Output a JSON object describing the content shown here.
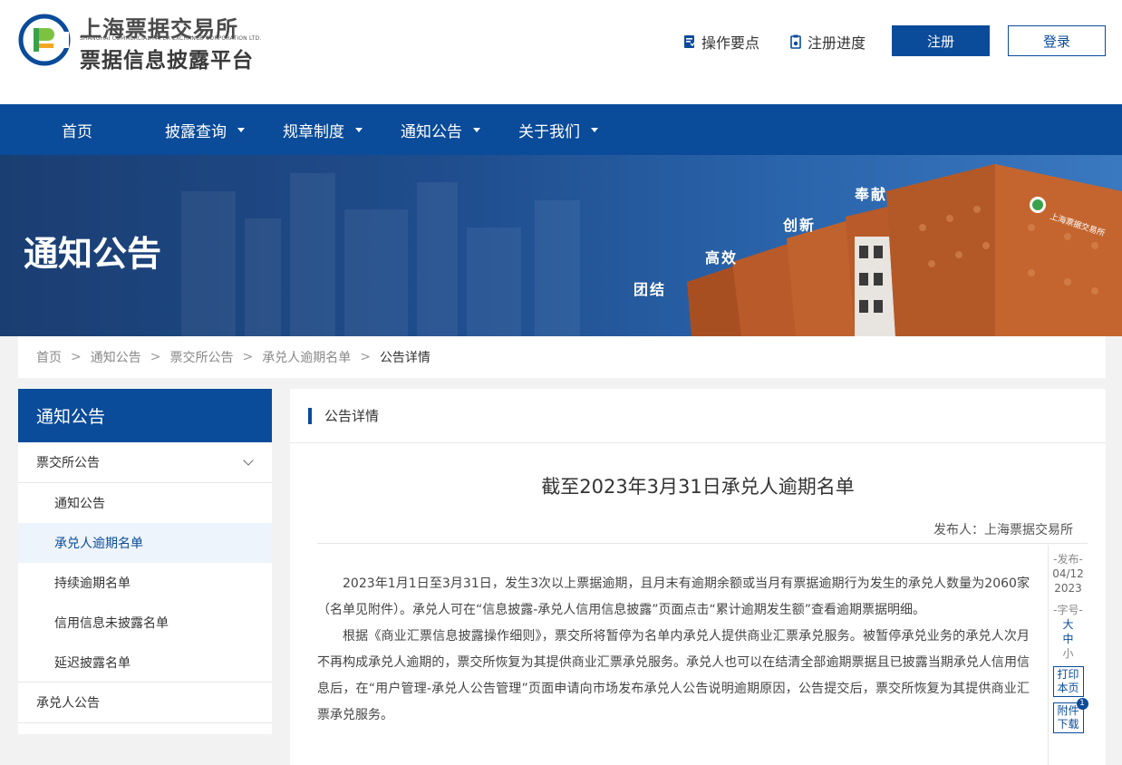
{
  "header": {
    "logo_cn": "上海票据交易所",
    "logo_en": "SHANGHAI COMMERCIAL PAPER EXCHANGE CORPORATION LTD.",
    "logo_sub": "票据信息披露平台",
    "links": [
      {
        "label": "操作要点",
        "icon": "document-icon"
      },
      {
        "label": "注册进度",
        "icon": "clipboard-icon"
      }
    ],
    "register_label": "注册",
    "login_label": "登录"
  },
  "nav": {
    "items": [
      {
        "label": "首页",
        "has_dropdown": false
      },
      {
        "label": "披露查询",
        "has_dropdown": true
      },
      {
        "label": "规章制度",
        "has_dropdown": true
      },
      {
        "label": "通知公告",
        "has_dropdown": true
      },
      {
        "label": "关于我们",
        "has_dropdown": true
      }
    ]
  },
  "banner": {
    "title": "通知公告",
    "mottos": [
      "团结",
      "高效",
      "创新",
      "奉献"
    ],
    "building_sign": "上海票据交易所"
  },
  "breadcrumb": [
    "首页",
    "通知公告",
    "票交所公告",
    "承兑人逾期名单",
    "公告详情"
  ],
  "sidebar": {
    "title": "通知公告",
    "group1": "票交所公告",
    "subitems": [
      "通知公告",
      "承兑人逾期名单",
      "持续逾期名单",
      "信用信息未披露名单",
      "延迟披露名单"
    ],
    "active_index": 1,
    "group2": "承兑人公告"
  },
  "main": {
    "section_title": "公告详情",
    "article_title": "截至2023年3月31日承兑人逾期名单",
    "publisher": "发布人：上海票据交易所",
    "paragraphs": [
      "2023年1月1日至3月31日，发生3次以上票据逾期，且月末有逾期余额或当月有票据逾期行为发生的承兑人数量为2060家（名单见附件）。承兑人可在“信息披露-承兑人信用信息披露”页面点击“累计逾期发生额”查看逾期票据明细。",
      "根据《商业汇票信息披露操作细则》，票交所将暂停为名单内承兑人提供商业汇票承兑服务。被暂停承兑业务的承兑人次月不再构成承兑人逾期的，票交所恢复为其提供商业汇票承兑服务。承兑人也可以在结清全部逾期票据且已披露当期承兑人信用信息后，在“用户管理-承兑人公告管理”页面申请向市场发布承兑人公告说明逾期原因，公告提交后，票交所恢复为其提供商业汇票承兑服务。"
    ]
  },
  "tools": {
    "publish_label": "-发布-",
    "date_md": "04/12",
    "date_y": "2023",
    "font_label": "-字号-",
    "sizes": [
      "大",
      "中",
      "小"
    ],
    "print_label": "打印本页",
    "attach_label": "附件下载",
    "attach_count": "1"
  },
  "colors": {
    "brand": "#0a4b9a",
    "banner": "#1f4d8d",
    "rust": "#b85a2a"
  }
}
